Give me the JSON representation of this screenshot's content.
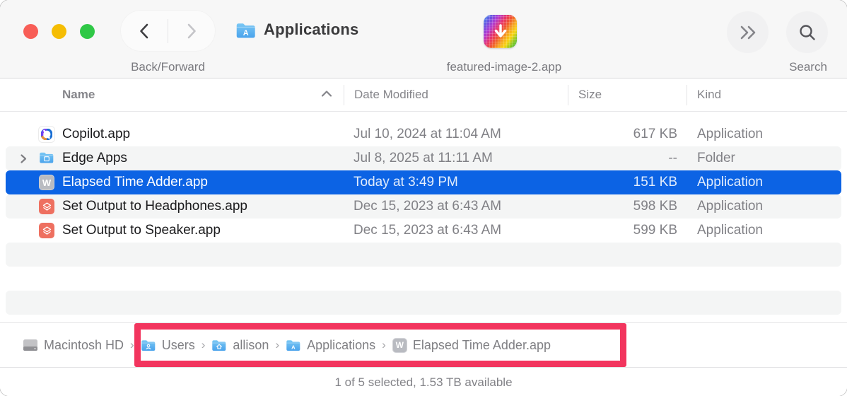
{
  "window": {
    "toolbar": {
      "back_forward_label": "Back/Forward",
      "title": "Applications",
      "featured_app_label": "featured-image-2.app",
      "search_label": "Search"
    },
    "columns": {
      "name": "Name",
      "date_modified": "Date Modified",
      "size": "Size",
      "kind": "Kind"
    },
    "files": [
      {
        "name": "Copilot.app",
        "date": "Jul 10, 2024 at 11:04 AM",
        "size": "617 KB",
        "kind": "Application",
        "icon": "copilot-icon",
        "selected": false
      },
      {
        "name": "Edge Apps",
        "date": "Jul 8, 2025 at 11:11 AM",
        "size": "--",
        "kind": "Folder",
        "icon": "folder-icon",
        "selected": false
      },
      {
        "name": "Elapsed Time Adder.app",
        "date": "Today at 3:49 PM",
        "size": "151 KB",
        "kind": "Application",
        "icon": "w-app-icon",
        "selected": true
      },
      {
        "name": "Set Output to Headphones.app",
        "date": "Dec 15, 2023 at 6:43 AM",
        "size": "598 KB",
        "kind": "Application",
        "icon": "shortcuts-icon",
        "selected": false
      },
      {
        "name": "Set Output to Speaker.app",
        "date": "Dec 15, 2023 at 6:43 AM",
        "size": "599 KB",
        "kind": "Application",
        "icon": "shortcuts-icon",
        "selected": false
      }
    ],
    "path_bar": {
      "separator": "›",
      "items": [
        {
          "label": "Macintosh HD",
          "icon": "drive-icon"
        },
        {
          "label": "Users",
          "icon": "users-folder-icon"
        },
        {
          "label": "allison",
          "icon": "home-folder-icon"
        },
        {
          "label": "Applications",
          "icon": "applications-folder-icon"
        },
        {
          "label": "Elapsed Time Adder.app",
          "icon": "w-app-icon"
        }
      ]
    },
    "status_bar": {
      "text": "1 of 5 selected, 1.53 TB available"
    },
    "colors": {
      "selection_blue": "#0c63e4",
      "annotation_red": "#f2355e",
      "folder_blue": "#55aeee",
      "shortcuts_orange": "#ee7060"
    }
  }
}
